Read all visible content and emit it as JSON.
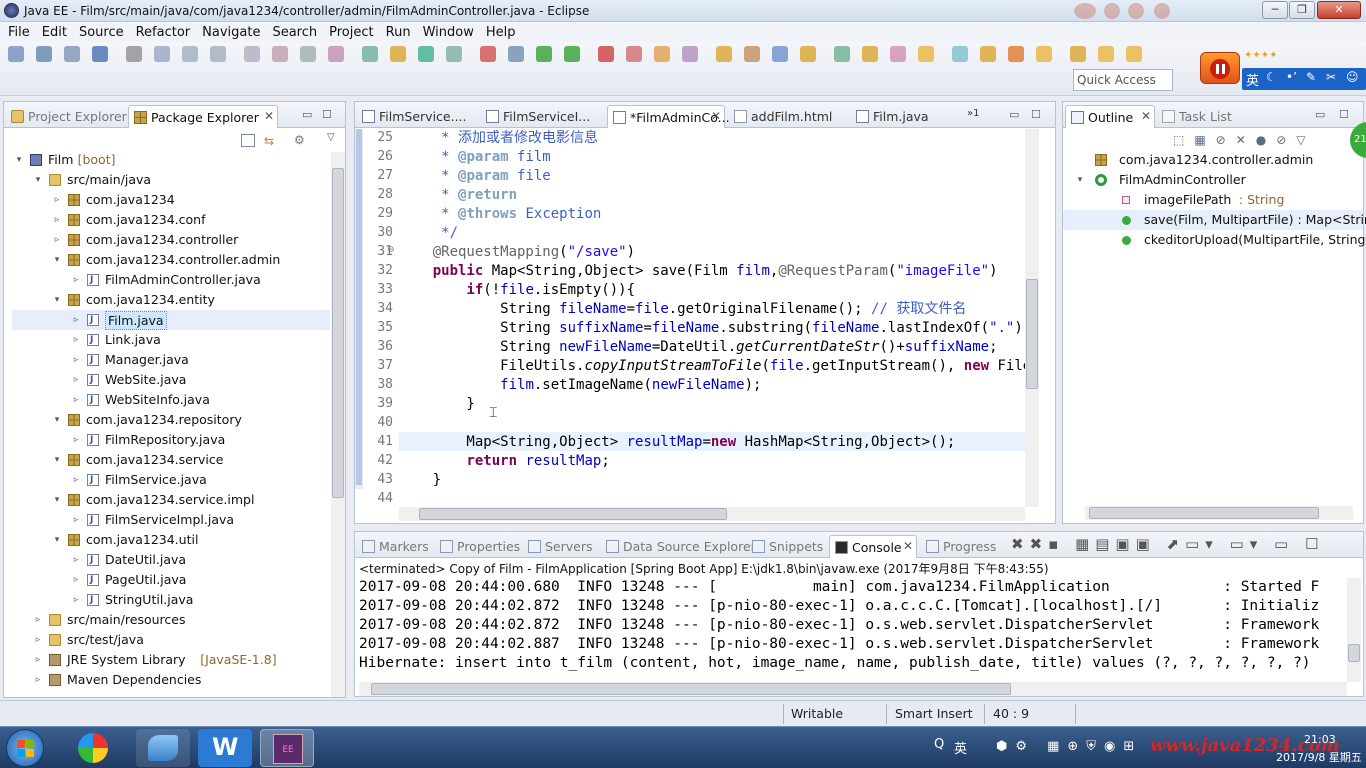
{
  "window": {
    "title": "Java EE - Film/src/main/java/com/java1234/controller/admin/FilmAdminController.java - Eclipse",
    "min_label": "─",
    "max_label": "❐",
    "close_label": "✕"
  },
  "menu": [
    "File",
    "Edit",
    "Source",
    "Refactor",
    "Navigate",
    "Search",
    "Project",
    "Run",
    "Window",
    "Help"
  ],
  "toolbar": {
    "quick_access_placeholder": "Quick Access",
    "ime_label": "英"
  },
  "left_panel": {
    "tabs": [
      {
        "label": "Project Explorer"
      },
      {
        "label": "Package Explorer",
        "close": "✕"
      }
    ],
    "tree": [
      {
        "depth": 0,
        "arrow": "▾",
        "icon": "proj",
        "label": "Film",
        "deco": " [boot]"
      },
      {
        "depth": 1,
        "arrow": "▾",
        "icon": "folder",
        "label": "src/main/java"
      },
      {
        "depth": 2,
        "arrow": "▹",
        "icon": "pkg",
        "label": "com.java1234"
      },
      {
        "depth": 2,
        "arrow": "▹",
        "icon": "pkg",
        "label": "com.java1234.conf"
      },
      {
        "depth": 2,
        "arrow": "▹",
        "icon": "pkg",
        "label": "com.java1234.controller"
      },
      {
        "depth": 2,
        "arrow": "▾",
        "icon": "pkg",
        "label": "com.java1234.controller.admin"
      },
      {
        "depth": 3,
        "arrow": "▹",
        "icon": "jfile",
        "label": "FilmAdminController.java"
      },
      {
        "depth": 2,
        "arrow": "▾",
        "icon": "pkg",
        "label": "com.java1234.entity"
      },
      {
        "depth": 3,
        "arrow": "▹",
        "icon": "jfile",
        "label": "Film.java",
        "selected": true
      },
      {
        "depth": 3,
        "arrow": "▹",
        "icon": "jfile",
        "label": "Link.java"
      },
      {
        "depth": 3,
        "arrow": "▹",
        "icon": "jfile",
        "label": "Manager.java"
      },
      {
        "depth": 3,
        "arrow": "▹",
        "icon": "jfile",
        "label": "WebSite.java"
      },
      {
        "depth": 3,
        "arrow": "▹",
        "icon": "jfile",
        "label": "WebSiteInfo.java"
      },
      {
        "depth": 2,
        "arrow": "▾",
        "icon": "pkg",
        "label": "com.java1234.repository"
      },
      {
        "depth": 3,
        "arrow": "▹",
        "icon": "jfile",
        "label": "FilmRepository.java"
      },
      {
        "depth": 2,
        "arrow": "▾",
        "icon": "pkg",
        "label": "com.java1234.service"
      },
      {
        "depth": 3,
        "arrow": "▹",
        "icon": "jfile",
        "label": "FilmService.java"
      },
      {
        "depth": 2,
        "arrow": "▾",
        "icon": "pkg",
        "label": "com.java1234.service.impl"
      },
      {
        "depth": 3,
        "arrow": "▹",
        "icon": "jfile",
        "label": "FilmServiceImpl.java"
      },
      {
        "depth": 2,
        "arrow": "▾",
        "icon": "pkg",
        "label": "com.java1234.util"
      },
      {
        "depth": 3,
        "arrow": "▹",
        "icon": "jfile",
        "label": "DateUtil.java"
      },
      {
        "depth": 3,
        "arrow": "▹",
        "icon": "jfile",
        "label": "PageUtil.java"
      },
      {
        "depth": 3,
        "arrow": "▹",
        "icon": "jfile",
        "label": "StringUtil.java"
      },
      {
        "depth": 1,
        "arrow": "▹",
        "icon": "folder",
        "label": "src/main/resources"
      },
      {
        "depth": 1,
        "arrow": "▹",
        "icon": "folder",
        "label": "src/test/java"
      },
      {
        "depth": 1,
        "arrow": "▹",
        "icon": "jar",
        "label": "JRE System Library",
        "deco": " [JavaSE-1.8]"
      },
      {
        "depth": 1,
        "arrow": "▹",
        "icon": "jar",
        "label": "Maven Dependencies"
      }
    ]
  },
  "editor": {
    "tabs": [
      {
        "label": "FilmService...."
      },
      {
        "label": "FilmServiceI..."
      },
      {
        "label": "*FilmAdminCo...",
        "active": true,
        "close": "✕"
      },
      {
        "label": "addFilm.html"
      },
      {
        "label": "Film.java"
      }
    ],
    "overflow_count": "1",
    "lines": [
      {
        "n": "25",
        "html": "<span class=\"c-cm\">     * 添加或者修改电影信息</span>"
      },
      {
        "n": "26",
        "html": "<span class=\"c-cm\">     * </span><span class=\"c-tag\">@param</span><span class=\"c-cm\"> film</span>"
      },
      {
        "n": "27",
        "html": "<span class=\"c-cm\">     * </span><span class=\"c-tag\">@param</span><span class=\"c-cm\"> file</span>"
      },
      {
        "n": "28",
        "html": "<span class=\"c-cm\">     * </span><span class=\"c-tag\">@return</span>"
      },
      {
        "n": "29",
        "html": "<span class=\"c-cm\">     * </span><span class=\"c-tag\">@throws</span><span class=\"c-cm\"> Exception</span>"
      },
      {
        "n": "30",
        "html": "<span class=\"c-cm\">     */</span>"
      },
      {
        "n": "31",
        "html": "    <span class=\"c-ann\">@RequestMapping</span>(<span class=\"c-str\">\"/save\"</span>)"
      },
      {
        "n": "32",
        "html": "    <span class=\"c-kw\">public</span> Map&lt;String,Object&gt; save(Film <span class=\"c-fld\">film</span>,<span class=\"c-ann\">@RequestParam</span>(<span class=\"c-str\">\"imageFile\"</span>)"
      },
      {
        "n": "33",
        "html": "        <span class=\"c-kw\">if</span>(!<span class=\"c-fld\">file</span>.isEmpty()){"
      },
      {
        "n": "34",
        "html": "            String <span class=\"c-fld\">fileName</span>=<span class=\"c-fld\">file</span>.getOriginalFilename(); <span class=\"c-cm\">// 获取文件名</span>"
      },
      {
        "n": "35",
        "html": "            String <span class=\"c-fld\">suffixName</span>=<span class=\"c-fld\">fileName</span>.substring(<span class=\"c-fld\">fileName</span>.lastIndexOf(<span class=\"c-str\">\".\"</span>));"
      },
      {
        "n": "36",
        "html": "            String <span class=\"c-fld\">newFileName</span>=DateUtil.<span class=\"c-it\">getCurrentDateStr</span>()+<span class=\"c-fld\">suffixName</span>;"
      },
      {
        "n": "37",
        "html": "            FileUtils.<span class=\"c-it\">copyInputStreamToFile</span>(<span class=\"c-fld\">file</span>.getInputStream(), <span class=\"c-kw\">new</span> File("
      },
      {
        "n": "38",
        "html": "            <span class=\"c-fld\">film</span>.setImageName(<span class=\"c-fld\">newFileName</span>);"
      },
      {
        "n": "39",
        "html": "        }"
      },
      {
        "n": "40",
        "html": ""
      },
      {
        "n": "41",
        "html": "        Map&lt;String,Object&gt; <span class=\"c-fld\">resultMap</span>=<span class=\"c-kw\">new</span> HashMap&lt;String,Object&gt;();"
      },
      {
        "n": "42",
        "html": "        <span class=\"c-kw\">return</span> <span class=\"c-fld\">resultMap</span>;"
      },
      {
        "n": "43",
        "html": "    }"
      },
      {
        "n": "44",
        "html": ""
      }
    ]
  },
  "outline": {
    "tabs": [
      {
        "label": "Outline",
        "close": "✕"
      },
      {
        "label": "Task List"
      }
    ],
    "items": [
      {
        "depth": 0,
        "arrow": "",
        "icon": "pkg",
        "label": "com.java1234.controller.admin",
        "type": ""
      },
      {
        "depth": 0,
        "arrow": "▾",
        "icon": "class",
        "label": "FilmAdminController",
        "type": ""
      },
      {
        "depth": 1,
        "arrow": "",
        "icon": "field",
        "label": "imageFilePath",
        "type": " : String"
      },
      {
        "depth": 1,
        "arrow": "",
        "icon": "method",
        "label": "save(Film, MultipartFile) : Map<String",
        "type": "",
        "selected": true
      },
      {
        "depth": 1,
        "arrow": "",
        "icon": "method",
        "label": "ckeditorUpload(MultipartFile, String)",
        "type": ""
      }
    ]
  },
  "console": {
    "tabs": [
      {
        "label": "Markers"
      },
      {
        "label": "Properties"
      },
      {
        "label": "Servers"
      },
      {
        "label": "Data Source Explorer"
      },
      {
        "label": "Snippets"
      },
      {
        "label": "Console",
        "active": true,
        "close": "✕"
      },
      {
        "label": "Progress"
      }
    ],
    "header": "<terminated> Copy of Film - FilmApplication [Spring Boot App] E:\\jdk1.8\\bin\\javaw.exe (2017年9月8日 下午8:43:55)",
    "lines": [
      "2017-09-08 20:44:00.680  INFO 13248 --- [           main] com.java1234.FilmApplication             : Started F",
      "2017-09-08 20:44:02.872  INFO 13248 --- [p-nio-80-exec-1] o.a.c.c.C.[Tomcat].[localhost].[/]       : Initializ",
      "2017-09-08 20:44:02.872  INFO 13248 --- [p-nio-80-exec-1] o.s.web.servlet.DispatcherServlet        : Framework",
      "2017-09-08 20:44:02.887  INFO 13248 --- [p-nio-80-exec-1] o.s.web.servlet.DispatcherServlet        : Framework",
      "Hibernate: insert into t_film (content, hot, image_name, name, publish_date, title) values (?, ?, ?, ?, ?, ?)"
    ]
  },
  "status": {
    "writable": "Writable",
    "insert_mode": "Smart Insert",
    "position": "40 : 9"
  },
  "taskbar": {
    "ime": "英",
    "time": "21:03",
    "date": "2017/9/8 星期五",
    "watermark": "www.java1234.com"
  },
  "colors": {
    "accent": "#3399ff",
    "selection": "#cce8ff",
    "close_red": "#c9402c"
  }
}
